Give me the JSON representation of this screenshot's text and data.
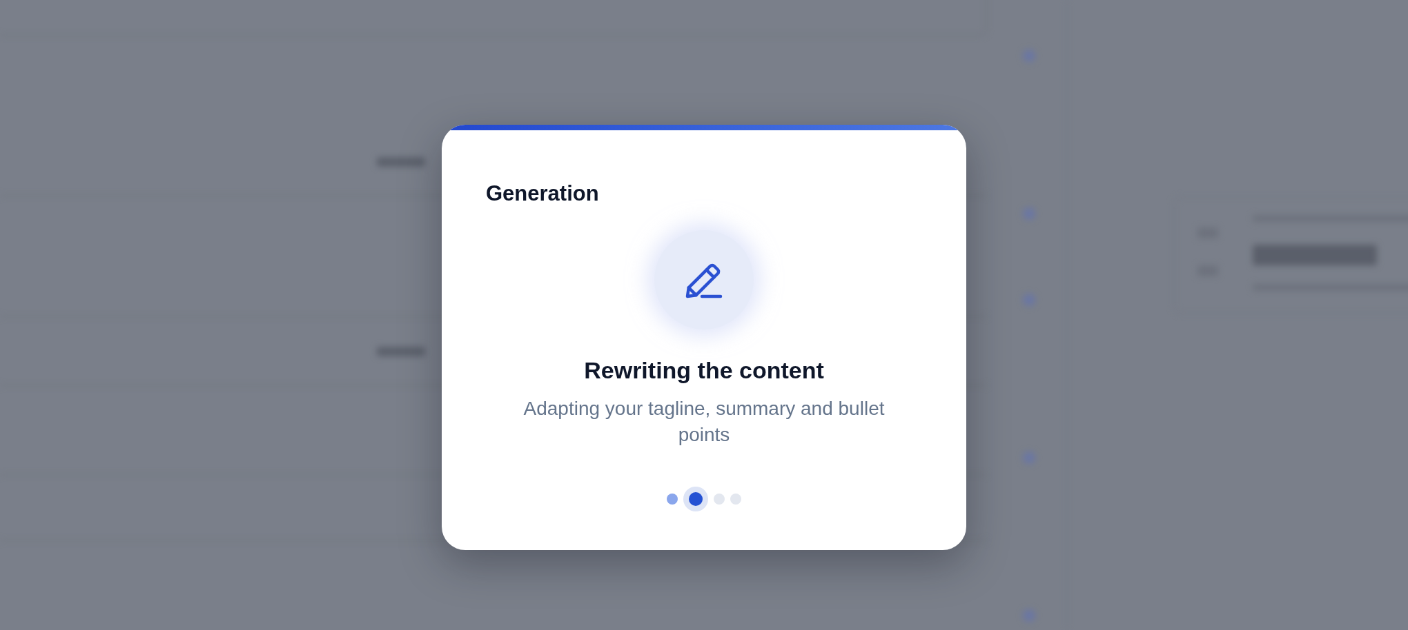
{
  "dialog": {
    "title": "Generation",
    "current_step": {
      "heading": "Rewriting the content",
      "description": "Adapting your tagline, summary and bullet points"
    },
    "steps": [
      {
        "done": true,
        "selected": false
      },
      {
        "done": false,
        "selected": true
      },
      {
        "done": false,
        "selected": false
      },
      {
        "done": false,
        "selected": false
      }
    ]
  }
}
